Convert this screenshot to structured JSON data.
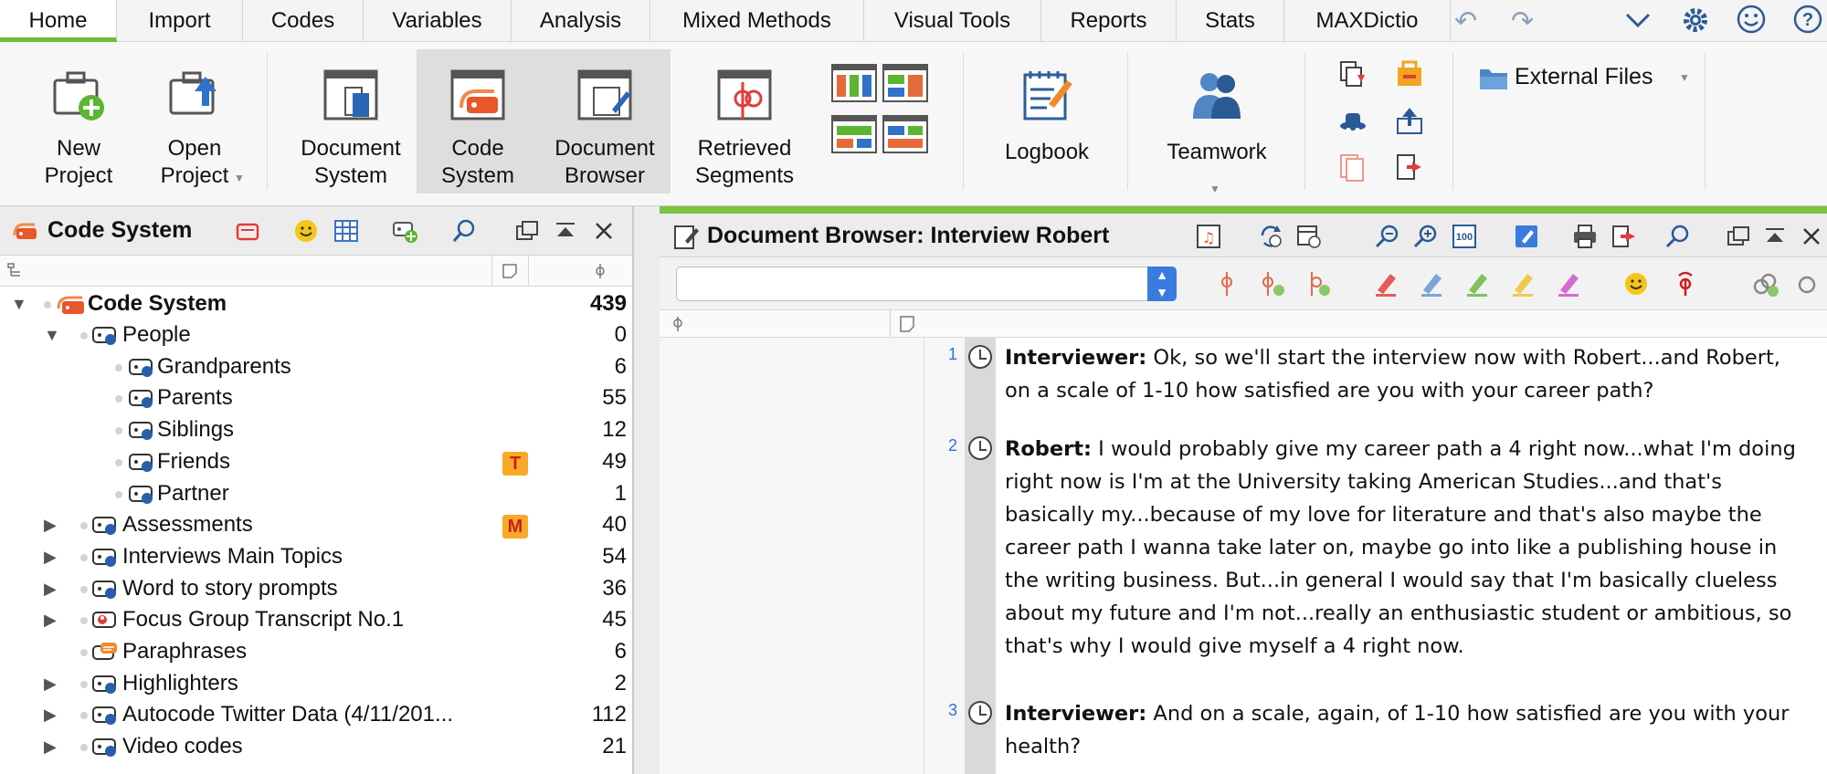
{
  "menu": {
    "tabs": [
      "Home",
      "Import",
      "Codes",
      "Variables",
      "Analysis",
      "Mixed Methods",
      "Visual Tools",
      "Reports",
      "Stats",
      "MAXDictio"
    ],
    "active_tab": "Home"
  },
  "ribbon": {
    "new_project": [
      "New",
      "Project"
    ],
    "open_project": [
      "Open",
      "Project"
    ],
    "document_system": [
      "Document",
      "System"
    ],
    "code_system": [
      "Code",
      "System"
    ],
    "document_browser": [
      "Document",
      "Browser"
    ],
    "retrieved_segments": [
      "Retrieved",
      "Segments"
    ],
    "logbook": "Logbook",
    "teamwork": "Teamwork",
    "external_files": "External Files"
  },
  "code_system_panel": {
    "title": "Code System",
    "root": {
      "name": "Code System",
      "count": "439"
    },
    "rows": [
      {
        "name": "People",
        "count": "0",
        "level": 1,
        "expanded": true
      },
      {
        "name": "Grandparents",
        "count": "6",
        "level": 2
      },
      {
        "name": "Parents",
        "count": "55",
        "level": 2
      },
      {
        "name": "Siblings",
        "count": "12",
        "level": 2
      },
      {
        "name": "Friends",
        "count": "49",
        "level": 2,
        "badge": "T"
      },
      {
        "name": "Partner",
        "count": "1",
        "level": 2
      },
      {
        "name": "Assessments",
        "count": "40",
        "level": 1,
        "badge": "M"
      },
      {
        "name": "Interviews Main Topics",
        "count": "54",
        "level": 1
      },
      {
        "name": "Word to story prompts",
        "count": "36",
        "level": 1
      },
      {
        "name": "Focus Group Transcript No.1",
        "count": "45",
        "level": 1
      },
      {
        "name": "Paraphrases",
        "count": "6",
        "level": 1
      },
      {
        "name": "Highlighters",
        "count": "2",
        "level": 1
      },
      {
        "name": "Autocode Twitter Data (4/11/201...",
        "count": "112",
        "level": 1
      },
      {
        "name": "Video codes",
        "count": "21",
        "level": 1
      }
    ]
  },
  "document_browser": {
    "title": "Document Browser: Interview Robert",
    "paragraphs": [
      {
        "line": "1",
        "speaker": "Interviewer:",
        "text": " Ok, so we'll start the interview now with Robert...and Robert, on a scale of 1-10 how satisfied are you with your career path?"
      },
      {
        "line": "2",
        "speaker": "Robert:",
        "text": " I would probably give my career path a 4 right now...what I'm doing right now is I'm at the University taking American Studies...and that's basically my...because of my love for literature and that's also maybe the career path I wanna take later on, maybe go into like a publishing house in the writing business. But...in general I would say that I'm basically clueless about my future and I'm not...really an enthusiastic student or ambitious, so that's why I would give myself a 4 right now."
      },
      {
        "line": "3",
        "speaker": "Interviewer:",
        "text": " And on a scale, again, of 1-10 how satisfied are you with your health?"
      }
    ]
  }
}
